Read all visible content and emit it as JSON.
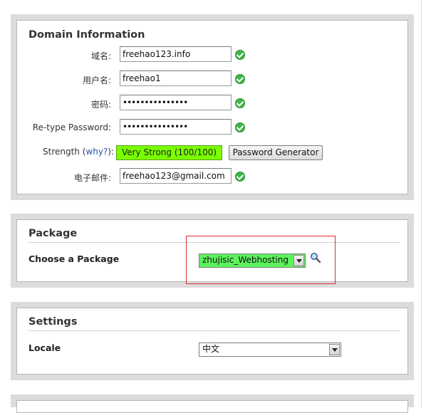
{
  "domain_info": {
    "title": "Domain Information",
    "fields": [
      {
        "label": "域名:",
        "value": "freehao123.info"
      },
      {
        "label": "用户名:",
        "value": "freehao1"
      },
      {
        "label": "密码:",
        "value": "•••••••••••••••"
      },
      {
        "label": "Re-type Password:",
        "value": "•••••••••••••••"
      }
    ],
    "strength_label": "Strength (",
    "strength_why": "why?",
    "strength_close": "):",
    "strength_value": "Very Strong (100/100)",
    "password_generator_label": "Password Generator",
    "email_label": "电子邮件:",
    "email_value": "freehao123@gmail.com"
  },
  "package": {
    "title": "Package",
    "choose_label": "Choose a Package",
    "selected": "zhujisic_Webhosting",
    "highlight_color": "#d62d2d",
    "selected_bg": "#5cf25c",
    "search_icon": "magnifier-icon"
  },
  "settings": {
    "title": "Settings",
    "locale_label": "Locale",
    "locale_selected": "中文"
  },
  "colors": {
    "valid_check": "#3fb74a",
    "strength_bg": "#79ff00"
  }
}
